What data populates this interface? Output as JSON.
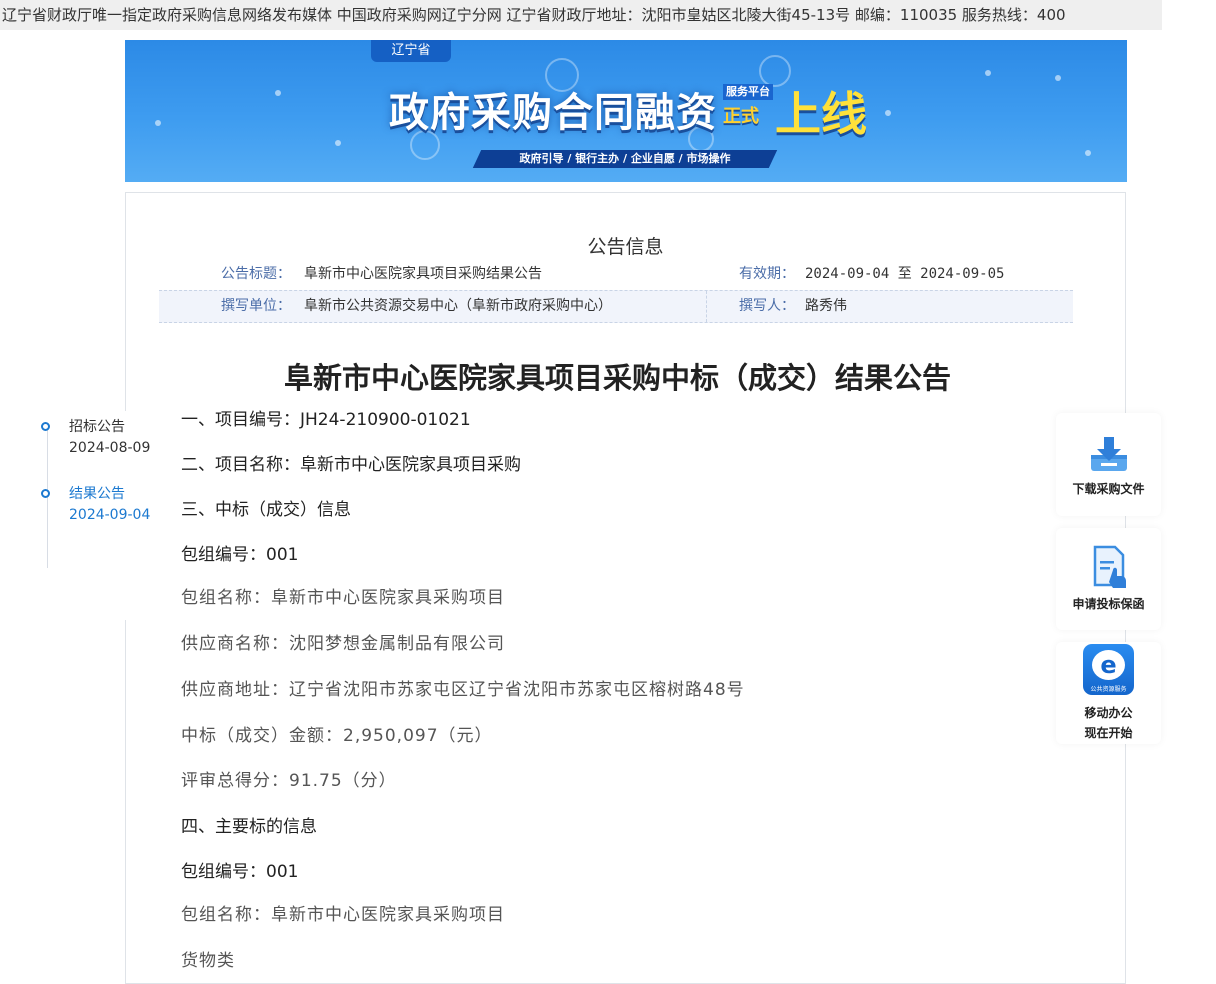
{
  "topbar": {
    "text": "辽宁省财政厅唯一指定政府采购信息网络发布媒体 中国政府采购网辽宁分网 辽宁省财政厅地址：沈阳市皇姑区北陵大街45-13号 邮编：110035 服务热线：400"
  },
  "banner": {
    "region": "辽宁省",
    "title": "政府采购合同融资",
    "platform_small": "服务平台",
    "platform_main": "正式",
    "online": "上线",
    "slogan": "政府引导 / 银行主办 / 企业自愿 / 市场操作"
  },
  "notice": {
    "heading": "公告信息",
    "title_label": "公告标题：",
    "title_value": "阜新市中心医院家具项目采购结果公告",
    "validity_label": "有效期：",
    "validity_value": "2024-09-04 至 2024-09-05",
    "unit_label": "撰写单位：",
    "unit_value": "阜新市公共资源交易中心（阜新市政府采购中心）",
    "writer_label": "撰写人：",
    "writer_value": "路秀伟"
  },
  "article": {
    "title": "阜新市中心医院家具项目采购中标（成交）结果公告",
    "lines": [
      "一、项目编号：JH24-210900-01021",
      "二、项目名称：阜新市中心医院家具项目采购",
      "三、中标（成交）信息",
      "包组编号：001",
      "包组名称：阜新市中心医院家具采购项目",
      "供应商名称：沈阳梦想金属制品有限公司",
      "供应商地址：辽宁省沈阳市苏家屯区辽宁省沈阳市苏家屯区榕树路48号",
      "中标（成交）金额：2,950,097（元）",
      "评审总得分：91.75（分）",
      "四、主要标的信息",
      "包组编号：001",
      "包组名称：阜新市中心医院家具采购项目",
      "货物类"
    ]
  },
  "timeline": {
    "items": [
      {
        "title": "招标公告",
        "date": "2024-08-09"
      },
      {
        "title": "结果公告",
        "date": "2024-09-04"
      }
    ]
  },
  "widgets": {
    "download": "下载采购文件",
    "guarantee": "申请投标保函",
    "mobile_line1": "移动办公",
    "mobile_line2": "现在开始",
    "app_caption": "公共资源服务"
  },
  "colors": {
    "accent": "#1c79d0",
    "label_blue": "#4b6da8",
    "banner_blue": "#2c8ae6",
    "banner_gold": "#ffe13a"
  }
}
